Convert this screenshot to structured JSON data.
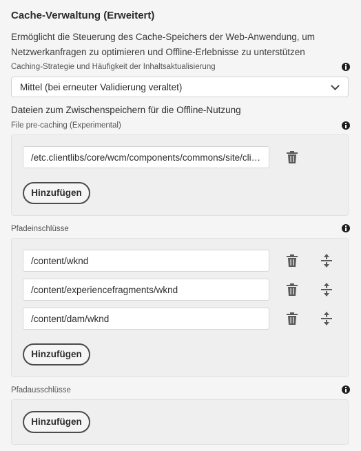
{
  "title": "Cache-Verwaltung (Erweitert)",
  "description": "Ermöglicht die Steuerung des Cache-Speichers der Web-Anwendung, um Netzwerkanfragen zu optimieren und Offline-Erlebnisse zu unterstützen",
  "caching": {
    "label": "Caching-Strategie und Häufigkeit der Inhaltsaktualisierung",
    "value": "Mittel (bei erneuter Validierung veraltet)"
  },
  "offline_heading": "Dateien zum Zwischenspeichern für die Offline-Nutzung",
  "precaching": {
    "label": "File pre-caching (Experimental)",
    "items": [
      "/etc.clientlibs/core/wcm/components/commons/site/clientlibs"
    ],
    "add_label": "Hinzufügen"
  },
  "inclusions": {
    "label": "Pfadeinschlüsse",
    "items": [
      "/content/wknd",
      "/content/experiencefragments/wknd",
      "/content/dam/wknd"
    ],
    "add_label": "Hinzufügen"
  },
  "exclusions": {
    "label": "Pfadausschlüsse",
    "add_label": "Hinzufügen"
  },
  "icons": {
    "info": "info-icon",
    "delete": "trash-icon",
    "reorder": "move-icon",
    "dropdown": "chevron-down-icon"
  }
}
